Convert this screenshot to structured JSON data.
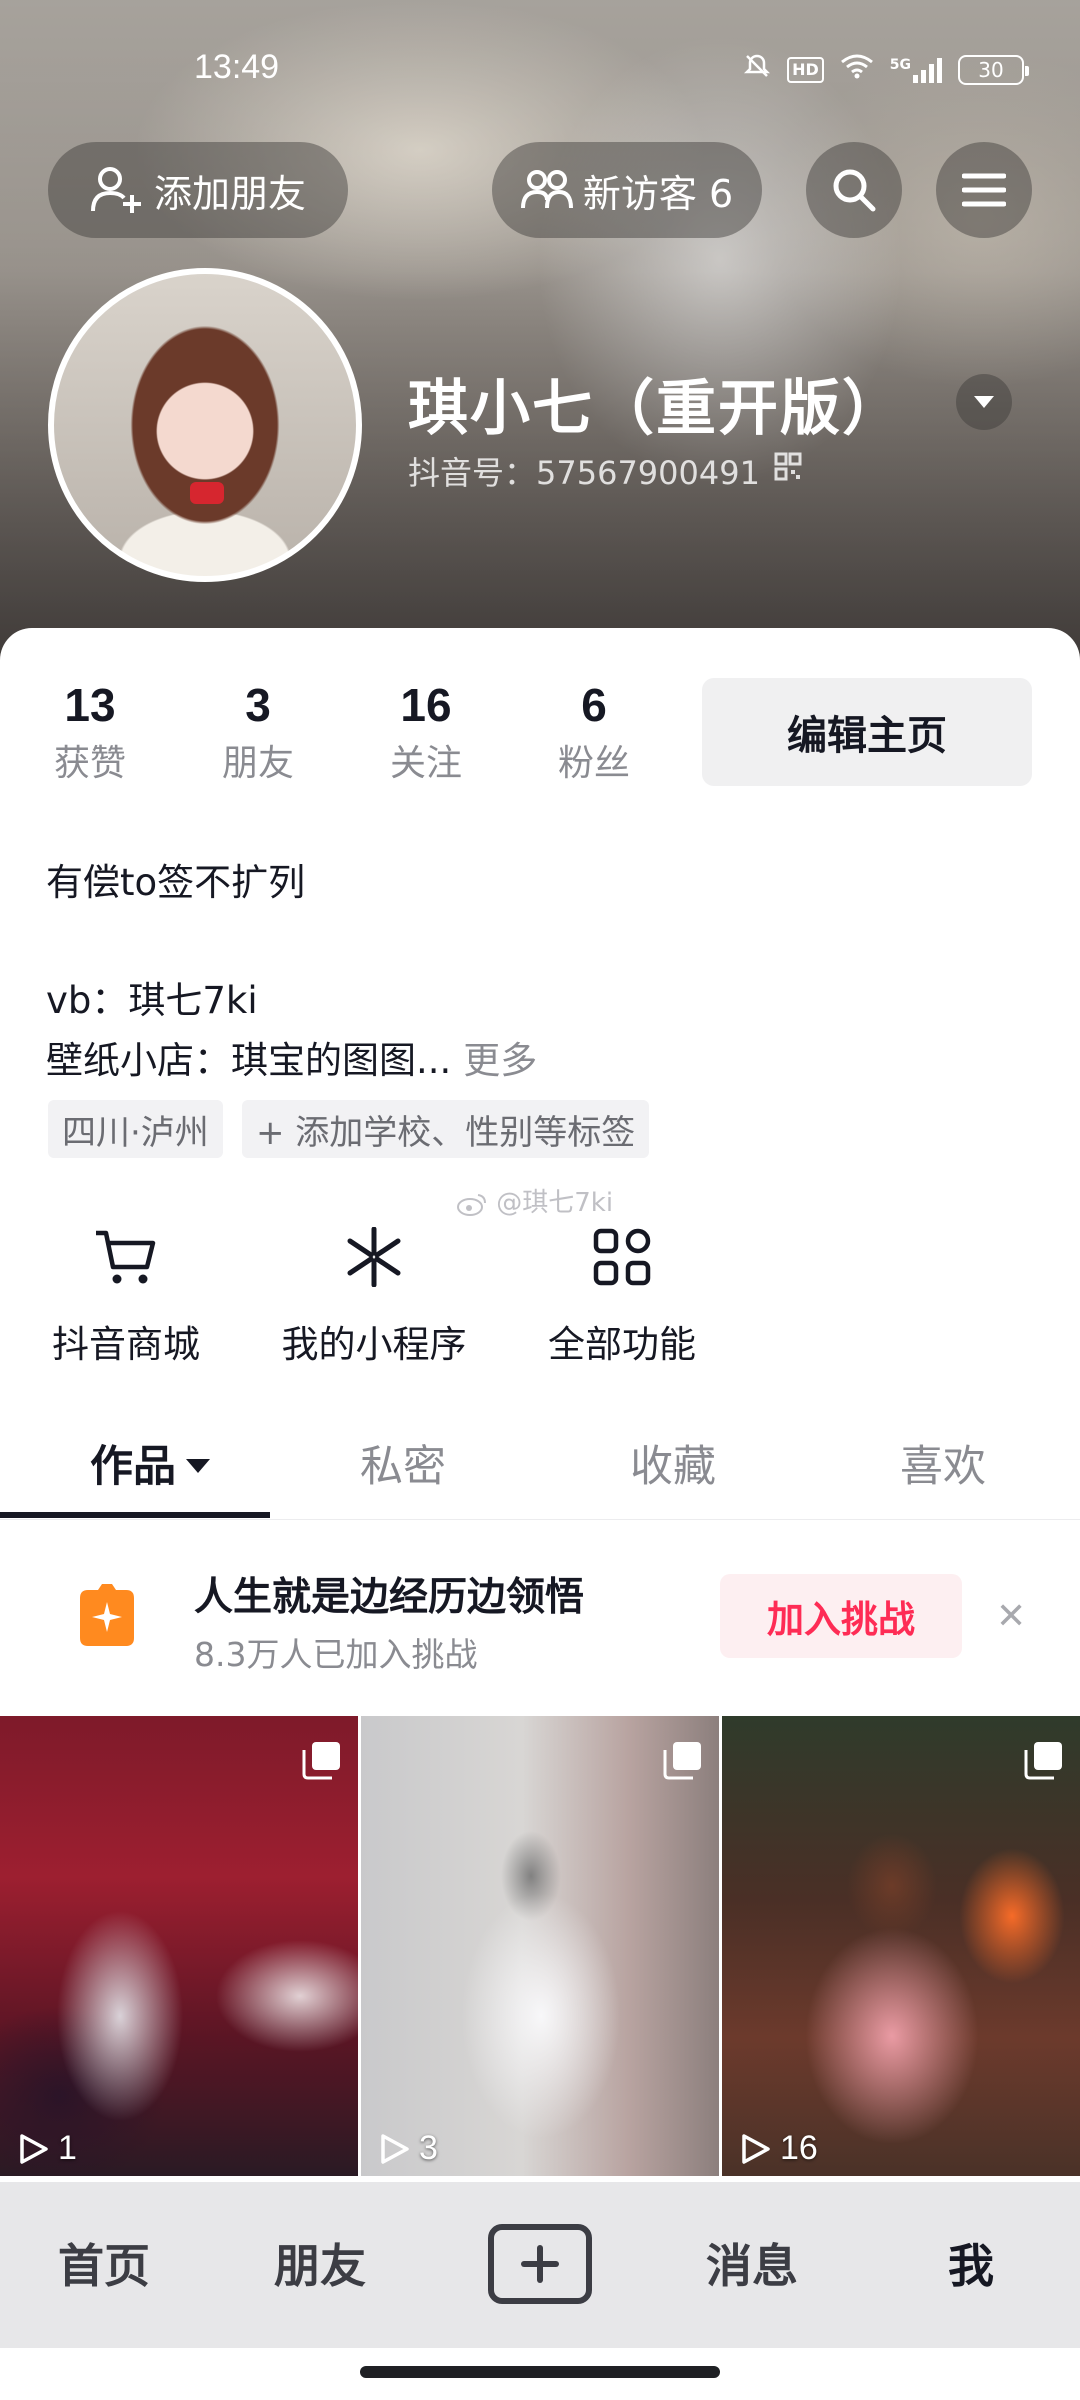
{
  "status_bar": {
    "time": "13:49",
    "hd": "HD",
    "network": "5G",
    "battery": "30"
  },
  "header": {
    "add_friend": "添加朋友",
    "new_visitors": "新访客 6"
  },
  "profile": {
    "name": "琪小七（重开版）",
    "douyin_id": "抖音号：57567900491"
  },
  "stats": [
    {
      "value": "13",
      "label": "获赞"
    },
    {
      "value": "3",
      "label": "朋友"
    },
    {
      "value": "16",
      "label": "关注"
    },
    {
      "value": "6",
      "label": "粉丝"
    }
  ],
  "edit_profile": "编辑主页",
  "bio": {
    "line1": "有偿to签不扩列",
    "line2": "vb：琪七7ki",
    "line3": "壁纸小店：琪宝的图图...",
    "more": "更多"
  },
  "tags": {
    "location": "四川·泸州",
    "add_tags": "+ 添加学校、性别等标签"
  },
  "watermark": "@琪七7ki",
  "functions": [
    {
      "label": "抖音商城",
      "icon": "cart-icon"
    },
    {
      "label": "我的小程序",
      "icon": "mini-program-icon"
    },
    {
      "label": "全部功能",
      "icon": "grid-icon"
    }
  ],
  "tabs": [
    "作品",
    "私密",
    "收藏",
    "喜欢"
  ],
  "challenge": {
    "title": "人生就是边经历边领悟",
    "subtitle": "8.3万人已加入挑战",
    "join": "加入挑战"
  },
  "videos": [
    {
      "plays": "1"
    },
    {
      "plays": "3"
    },
    {
      "plays": "16"
    }
  ],
  "bottom_nav": {
    "home": "首页",
    "friends": "朋友",
    "messages": "消息",
    "me": "我"
  },
  "colors": {
    "accent": "#fe2c55",
    "text": "#161823",
    "muted": "#8a8b91"
  }
}
